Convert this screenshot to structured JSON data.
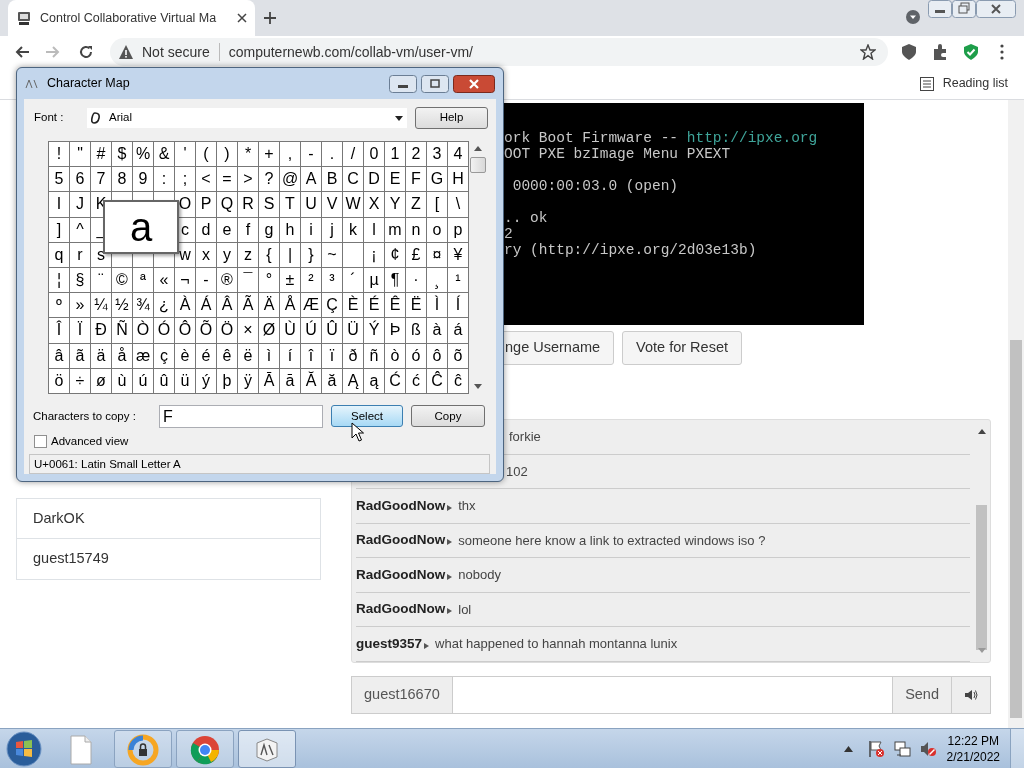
{
  "browser": {
    "tab_title": "Control Collaborative Virtual Ma",
    "security": "Not secure",
    "url": "computernewb.com/collab-vm/user-vm/",
    "reading_list": "Reading list"
  },
  "vm_screen": {
    "lines": [
      [
        {
          "kind": "plain",
          "text": "ork Boot Firmware -- "
        },
        {
          "kind": "link",
          "text": "http://ipxe.org"
        }
      ],
      [
        {
          "kind": "plain",
          "text": "OOT PXE bzImage Menu PXEXT"
        }
      ],
      [
        {
          "kind": "blank"
        },
        {
          "kind": "plain",
          "text": " 0000:00:03.0 (open)"
        }
      ],
      [
        {
          "kind": "blank"
        },
        {
          "kind": "plain",
          "text": ".. ok"
        }
      ],
      [
        {
          "kind": "plain",
          "text": "2"
        }
      ],
      [
        {
          "kind": "plain",
          "text": "ry (http://ipxe.org/2d03e13b)"
        }
      ]
    ]
  },
  "vm_buttons": [
    "nge Username",
    "Vote for Reset"
  ],
  "users": [
    "DarkOK",
    "guest15749"
  ],
  "chat": {
    "messages": [
      {
        "text": "forkie"
      },
      {
        "text": "102"
      },
      {
        "user": "RadGoodNow",
        "text": "thx"
      },
      {
        "user": "RadGoodNow",
        "text": "someone here know a link to extracted windows iso ?"
      },
      {
        "user": "RadGoodNow",
        "text": "nobody"
      },
      {
        "user": "RadGoodNow",
        "text": "lol"
      },
      {
        "user": "guest9357",
        "text": "what happened to hannah montanna lunix"
      }
    ],
    "username": "guest16670",
    "send": "Send"
  },
  "charmap": {
    "title": "Character Map",
    "font_label": "Font :",
    "font": "Arial",
    "help": "Help",
    "grid": [
      [
        "!",
        "\"",
        "#",
        "$",
        "%",
        "&",
        "'",
        "(",
        ")",
        "*",
        "+",
        ",",
        "-",
        ".",
        "/",
        "0",
        "1",
        "2",
        "3",
        "4"
      ],
      [
        "5",
        "6",
        "7",
        "8",
        "9",
        ":",
        ";",
        "<",
        "=",
        ">",
        "?",
        "@",
        "A",
        "B",
        "C",
        "D",
        "E",
        "F",
        "G",
        "H"
      ],
      {
        "before": [
          "I",
          "J",
          "K"
        ],
        "after": [
          "O",
          "P",
          "Q",
          "R",
          "S",
          "T",
          "U",
          "V",
          "W",
          "X",
          "Y",
          "Z",
          "[",
          "\\"
        ]
      },
      {
        "before": [
          "]",
          "^",
          "_"
        ],
        "after": [
          "c",
          "d",
          "e",
          "f",
          "g",
          "h",
          "i",
          "j",
          "k",
          "l",
          "m",
          "n",
          "o",
          "p"
        ]
      },
      {
        "before": [
          "q",
          "r",
          "s"
        ],
        "after": [
          "w",
          "x",
          "y",
          "z",
          "{",
          "|",
          "}",
          "~",
          {
            "kind": "blank"
          },
          "¡",
          "¢",
          "£",
          "¤",
          "¥"
        ]
      },
      [
        "¦",
        "§",
        "¨",
        "©",
        "ª",
        "«",
        "¬",
        "-",
        "®",
        "¯",
        "°",
        "±",
        "²",
        "³",
        "´",
        "µ",
        "¶",
        "·",
        "¸",
        "¹"
      ],
      [
        "º",
        "»",
        "¼",
        "½",
        "¾",
        "¿",
        "À",
        "Á",
        "Â",
        "Ã",
        "Ä",
        "Å",
        "Æ",
        "Ç",
        "È",
        "É",
        "Ê",
        "Ë",
        "Ì",
        "Í"
      ],
      [
        "Î",
        "Ï",
        "Ð",
        "Ñ",
        "Ò",
        "Ó",
        "Ô",
        "Õ",
        "Ö",
        "×",
        "Ø",
        "Ù",
        "Ú",
        "Û",
        "Ü",
        "Ý",
        "Þ",
        "ß",
        "à",
        "á"
      ],
      [
        "â",
        "ã",
        "ä",
        "å",
        "æ",
        "ç",
        "è",
        "é",
        "ê",
        "ë",
        "ì",
        "í",
        "î",
        "ï",
        "ð",
        "ñ",
        "ò",
        "ó",
        "ô",
        "õ"
      ],
      [
        "ö",
        "÷",
        "ø",
        "ù",
        "ú",
        "û",
        "ü",
        "ý",
        "þ",
        "ÿ",
        "Ā",
        "ā",
        "Ă",
        "ă",
        "Ą",
        "ą",
        "Ć",
        "ć",
        "Ĉ",
        "ĉ"
      ]
    ],
    "magnified": "a",
    "copy_label": "Characters to copy :",
    "copy_value": "F",
    "select": "Select",
    "copy": "Copy",
    "advanced": {
      "label": "Advanced view",
      "checked": false
    },
    "status": "U+0061: Latin Small Letter A"
  },
  "taskbar": {
    "apps": [
      {
        "kind": "file",
        "running": false,
        "selected": false
      },
      {
        "kind": "browser-lock",
        "running": true,
        "selected": false
      },
      {
        "kind": "chrome",
        "running": true,
        "selected": false
      },
      {
        "kind": "charmap",
        "running": true,
        "selected": true
      }
    ],
    "time": "12:22 PM",
    "date": "2/21/2022"
  }
}
